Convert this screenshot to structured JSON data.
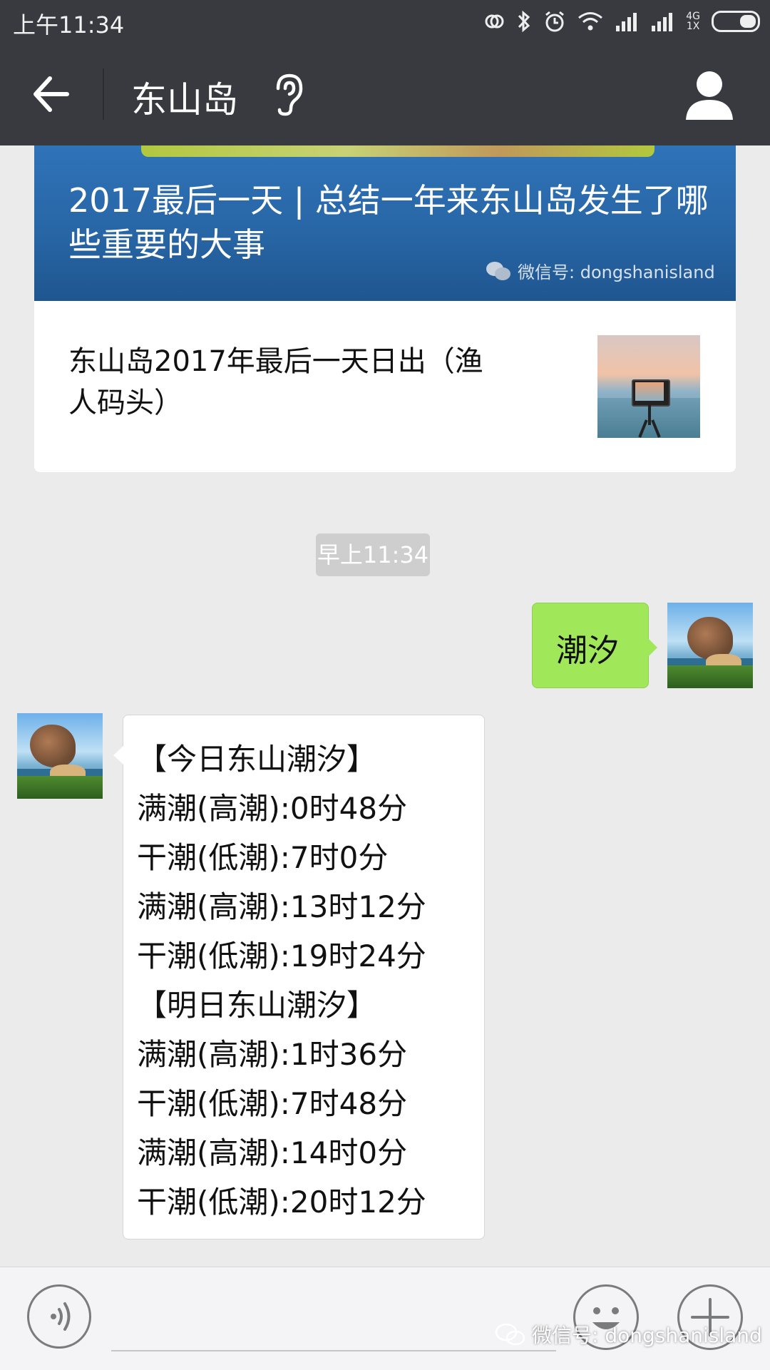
{
  "status_bar": {
    "time": "上午11:34",
    "network_top": "4G",
    "network_bottom": "1X"
  },
  "header": {
    "title": "东山岛"
  },
  "article": {
    "banner_title": "2017最后一天 | 总结一年来东山岛发生了哪些重要的大事",
    "banner_watermark": "微信号: dongshanisland",
    "sub_title": "东山岛2017年最后一天日出（渔人码头）"
  },
  "timestamp": "早上11:34",
  "sent_message": "潮汐",
  "received_message": {
    "lines": [
      "【今日东山潮汐】",
      "满潮(高潮):0时48分",
      "干潮(低潮):7时0分",
      "满潮(高潮):13时12分",
      "干潮(低潮):19时24分",
      "【明日东山潮汐】",
      "满潮(高潮):1时36分",
      "干潮(低潮):7时48分",
      "满潮(高潮):14时0分",
      "干潮(低潮):20时12分"
    ]
  },
  "bottom_watermark": "微信号: dongshanisland",
  "icons": {
    "back": "back-arrow-icon",
    "ear": "ear-icon",
    "profile": "person-icon",
    "voice": "voice-icon",
    "emoji": "emoji-icon",
    "plus": "plus-icon"
  },
  "colors": {
    "header_bg": "#393a3f",
    "sent_bubble": "#a0e75a",
    "chat_bg": "#ebebeb",
    "banner_blue": "#2866a6"
  }
}
